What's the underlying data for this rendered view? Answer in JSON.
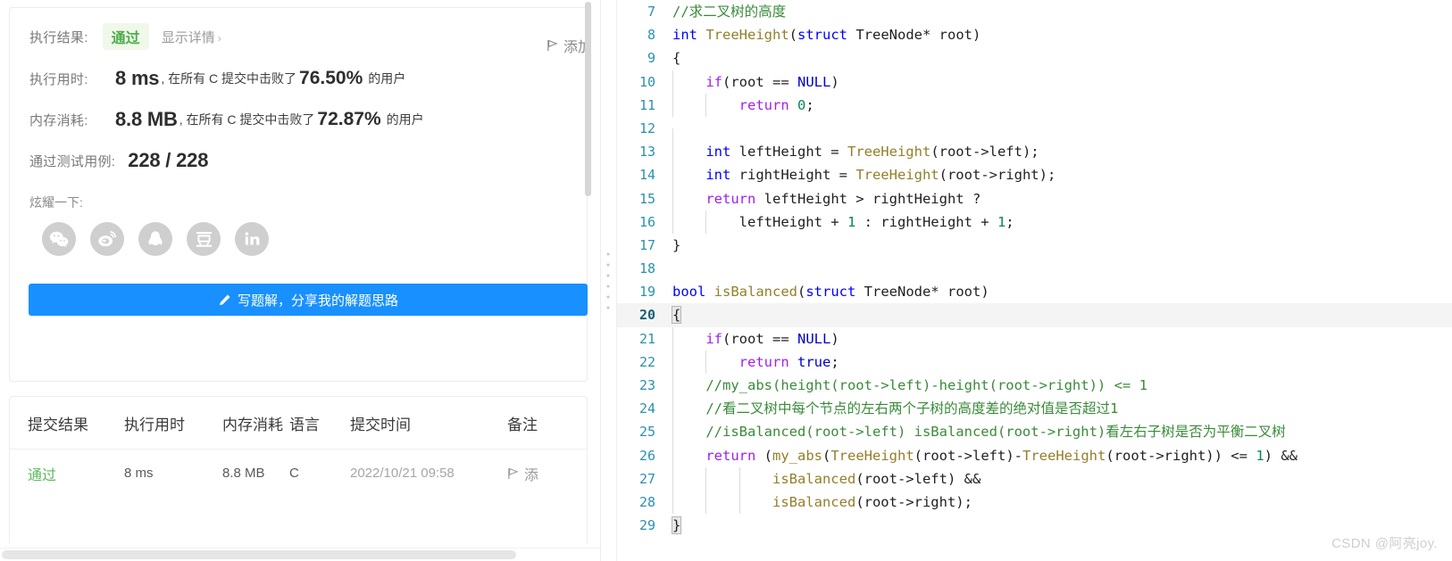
{
  "result_panel": {
    "execution_result": {
      "label": "执行结果:",
      "status": "通过",
      "detail_link": "显示详情",
      "chevron": "›"
    },
    "add_note": {
      "label": "添加",
      "icon": "flag-icon"
    },
    "runtime": {
      "label": "执行用时:",
      "value": "8 ms",
      "mid_text": ", 在所有 C 提交中击败了",
      "percent": "76.50%",
      "suffix": "的用户"
    },
    "memory": {
      "label": "内存消耗:",
      "value": "8.8 MB",
      "mid_text": ", 在所有 C 提交中击败了",
      "percent": "72.87%",
      "suffix": "的用户"
    },
    "testcases": {
      "label": "通过测试用例:",
      "value": "228 / 228"
    },
    "share": {
      "label": "炫耀一下:",
      "icons": [
        {
          "name": "wechat-icon",
          "title": "微信"
        },
        {
          "name": "weibo-icon",
          "title": "微博"
        },
        {
          "name": "qq-icon",
          "title": "QQ"
        },
        {
          "name": "douban-icon",
          "title": "豆瓣"
        },
        {
          "name": "linkedin-icon",
          "title": "LinkedIn"
        }
      ]
    },
    "write_solution_button": {
      "label": "写题解，分享我的解题思路",
      "icon": "pencil-icon",
      "color": "#1890ff"
    }
  },
  "submissions_table": {
    "headers": [
      "提交结果",
      "执行用时",
      "内存消耗",
      "语言",
      "提交时间",
      "备注"
    ],
    "rows": [
      {
        "result": "通过",
        "runtime": "8 ms",
        "memory": "8.8 MB",
        "language": "C",
        "submit_time": "2022/10/21 09:58",
        "note": "添"
      }
    ],
    "result_color": "#5cb85c"
  },
  "code_editor": {
    "first_line_number": 7,
    "current_line": 20,
    "lines": [
      {
        "n": 7,
        "indent": 0,
        "tokens": [
          {
            "t": "//求二叉树的高度",
            "c": "cmt"
          }
        ]
      },
      {
        "n": 8,
        "indent": 0,
        "tokens": [
          {
            "t": "int",
            "c": "kw"
          },
          {
            "t": " "
          },
          {
            "t": "TreeHeight",
            "c": "fn"
          },
          {
            "t": "("
          },
          {
            "t": "struct",
            "c": "kw"
          },
          {
            "t": " TreeNode* root)"
          }
        ]
      },
      {
        "n": 9,
        "indent": 0,
        "tokens": [
          {
            "t": "{"
          }
        ]
      },
      {
        "n": 10,
        "indent": 1,
        "tokens": [
          {
            "t": "    "
          },
          {
            "t": "if",
            "c": "kw2"
          },
          {
            "t": "(root == "
          },
          {
            "t": "NULL",
            "c": "mem"
          },
          {
            "t": ")"
          }
        ]
      },
      {
        "n": 11,
        "indent": 2,
        "tokens": [
          {
            "t": "        "
          },
          {
            "t": "return",
            "c": "kw2"
          },
          {
            "t": " "
          },
          {
            "t": "0",
            "c": "num"
          },
          {
            "t": ";"
          }
        ]
      },
      {
        "n": 12,
        "indent": 1,
        "tokens": [
          {
            "t": ""
          }
        ]
      },
      {
        "n": 13,
        "indent": 1,
        "tokens": [
          {
            "t": "    "
          },
          {
            "t": "int",
            "c": "kw"
          },
          {
            "t": " leftHeight = "
          },
          {
            "t": "TreeHeight",
            "c": "fn"
          },
          {
            "t": "(root->left);"
          }
        ]
      },
      {
        "n": 14,
        "indent": 1,
        "tokens": [
          {
            "t": "    "
          },
          {
            "t": "int",
            "c": "kw"
          },
          {
            "t": " rightHeight = "
          },
          {
            "t": "TreeHeight",
            "c": "fn"
          },
          {
            "t": "(root->right);"
          }
        ]
      },
      {
        "n": 15,
        "indent": 1,
        "tokens": [
          {
            "t": "    "
          },
          {
            "t": "return",
            "c": "kw2"
          },
          {
            "t": " leftHeight > rightHeight ?"
          }
        ]
      },
      {
        "n": 16,
        "indent": 2,
        "tokens": [
          {
            "t": "        leftHeight + "
          },
          {
            "t": "1",
            "c": "num"
          },
          {
            "t": " : rightHeight + "
          },
          {
            "t": "1",
            "c": "num"
          },
          {
            "t": ";"
          }
        ]
      },
      {
        "n": 17,
        "indent": 0,
        "tokens": [
          {
            "t": "}"
          }
        ]
      },
      {
        "n": 18,
        "indent": 0,
        "tokens": [
          {
            "t": ""
          }
        ]
      },
      {
        "n": 19,
        "indent": 0,
        "tokens": [
          {
            "t": "bool",
            "c": "kw"
          },
          {
            "t": " "
          },
          {
            "t": "isBalanced",
            "c": "fn"
          },
          {
            "t": "("
          },
          {
            "t": "struct",
            "c": "kw"
          },
          {
            "t": " TreeNode* root)"
          }
        ]
      },
      {
        "n": 20,
        "indent": 0,
        "tokens": [
          {
            "t": "{",
            "c": "brkt"
          }
        ]
      },
      {
        "n": 21,
        "indent": 1,
        "tokens": [
          {
            "t": "    "
          },
          {
            "t": "if",
            "c": "kw2"
          },
          {
            "t": "(root == "
          },
          {
            "t": "NULL",
            "c": "mem"
          },
          {
            "t": ")"
          }
        ]
      },
      {
        "n": 22,
        "indent": 2,
        "tokens": [
          {
            "t": "        "
          },
          {
            "t": "return",
            "c": "kw2"
          },
          {
            "t": " "
          },
          {
            "t": "true",
            "c": "mem"
          },
          {
            "t": ";"
          }
        ]
      },
      {
        "n": 23,
        "indent": 1,
        "tokens": [
          {
            "t": "    //my_abs(height(root->left)-height(root->right)) <= 1",
            "c": "cmt"
          }
        ]
      },
      {
        "n": 24,
        "indent": 1,
        "tokens": [
          {
            "t": "    //看二叉树中每个节点的左右两个子树的高度差的绝对值是否超过1",
            "c": "cmt"
          }
        ]
      },
      {
        "n": 25,
        "indent": 1,
        "tokens": [
          {
            "t": "    //isBalanced(root->left) isBalanced(root->right)看左右子树是否为平衡二叉树",
            "c": "cmt"
          }
        ]
      },
      {
        "n": 26,
        "indent": 1,
        "tokens": [
          {
            "t": "    "
          },
          {
            "t": "return",
            "c": "kw2"
          },
          {
            "t": " ("
          },
          {
            "t": "my_abs",
            "c": "fn"
          },
          {
            "t": "("
          },
          {
            "t": "TreeHeight",
            "c": "fn"
          },
          {
            "t": "(root->left)-"
          },
          {
            "t": "TreeHeight",
            "c": "fn"
          },
          {
            "t": "(root->right)) <= "
          },
          {
            "t": "1",
            "c": "num"
          },
          {
            "t": ") &&"
          }
        ]
      },
      {
        "n": 27,
        "indent": 3,
        "tokens": [
          {
            "t": "            "
          },
          {
            "t": "isBalanced",
            "c": "fn"
          },
          {
            "t": "(root->left) &&"
          }
        ]
      },
      {
        "n": 28,
        "indent": 3,
        "tokens": [
          {
            "t": "            "
          },
          {
            "t": "isBalanced",
            "c": "fn"
          },
          {
            "t": "(root->right);"
          }
        ]
      },
      {
        "n": 29,
        "indent": 0,
        "tokens": [
          {
            "t": "}",
            "c": "brkt"
          }
        ]
      }
    ],
    "colors": {
      "keyword_type": "#0000ff",
      "keyword_flow": "#a020f0",
      "function": "#937f2b",
      "comment": "#3a8b3a",
      "number": "#098658",
      "gutter": "#2b91af",
      "current_line_bg": "#f4f4f4"
    }
  },
  "watermark": {
    "text": "CSDN @阿亮joy."
  }
}
